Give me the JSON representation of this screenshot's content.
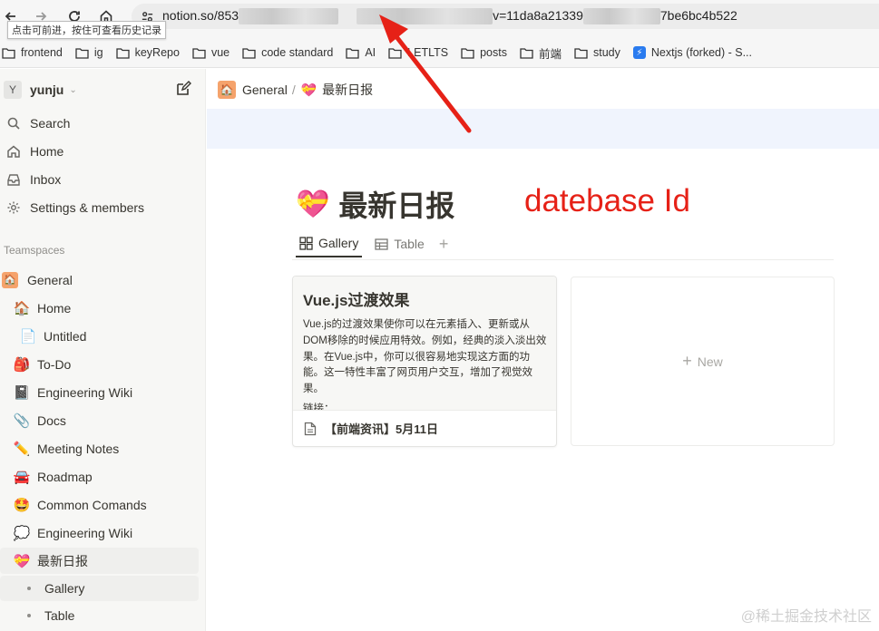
{
  "browser": {
    "url_host": "notion.so/853",
    "url_mid": "v=11da8a21339",
    "url_tail": "7be6bc4b522",
    "tooltip": "点击可前进，按住可查看历史记录"
  },
  "bookmarks": [
    {
      "label": "frontend",
      "icon": "folder-icon"
    },
    {
      "label": "ig",
      "icon": "folder-icon"
    },
    {
      "label": "keyRepo",
      "icon": "folder-icon"
    },
    {
      "label": "vue",
      "icon": "folder-icon"
    },
    {
      "label": "code standard",
      "icon": "folder-icon"
    },
    {
      "label": "AI",
      "icon": "folder-icon"
    },
    {
      "label": "LETLTS",
      "icon": "folder-icon"
    },
    {
      "label": "posts",
      "icon": "folder-icon"
    },
    {
      "label": "前端",
      "icon": "folder-icon"
    },
    {
      "label": "study",
      "icon": "folder-icon"
    },
    {
      "label": "Nextjs (forked) - S...",
      "icon": "bolt-icon"
    }
  ],
  "sidebar": {
    "workspace": {
      "avatar": "Y",
      "name": "yunju"
    },
    "nav": [
      {
        "label": "Search",
        "icon": "search-icon"
      },
      {
        "label": "Home",
        "icon": "home-icon"
      },
      {
        "label": "Inbox",
        "icon": "inbox-icon"
      },
      {
        "label": "Settings & members",
        "icon": "gear-icon"
      }
    ],
    "section_label": "Teamspaces",
    "teamspace": {
      "label": "General",
      "emoji": "🏠"
    },
    "pages": [
      {
        "label": "Home",
        "emoji": "🏠"
      },
      {
        "label": "Untitled",
        "emoji": "📄"
      },
      {
        "label": "To-Do",
        "emoji": "🎒"
      },
      {
        "label": "Engineering Wiki",
        "emoji": "📓"
      },
      {
        "label": "Docs",
        "emoji": "📎"
      },
      {
        "label": "Meeting Notes",
        "emoji": "✏️"
      },
      {
        "label": "Roadmap",
        "emoji": "🚘"
      },
      {
        "label": "Common Comands",
        "emoji": "🤩"
      },
      {
        "label": "Engineering Wiki",
        "emoji": "💭"
      },
      {
        "label": "最新日报",
        "emoji": "💝"
      }
    ],
    "subpages": [
      {
        "label": "Gallery"
      },
      {
        "label": "Table"
      }
    ]
  },
  "main": {
    "breadcrumb": {
      "parent": "General",
      "separator": "/",
      "current": "最新日报",
      "parent_emoji": "🏠",
      "current_emoji": "💝"
    },
    "title": "最新日报",
    "title_emoji": "💝",
    "annotation": "datebase Id",
    "tabs": [
      {
        "label": "Gallery",
        "icon": "gallery-icon",
        "active": true
      },
      {
        "label": "Table",
        "icon": "table-icon",
        "active": false
      }
    ],
    "add_view": "+",
    "card": {
      "heading": "Vue.js过渡效果",
      "body": "Vue.js的过渡效果使你可以在元素插入、更新或从DOM移除的时候应用特效。例如，经典的淡入淡出效果。在Vue.js中，你可以很容易地实现这方面的功能。这一特性丰富了网页用户交互，增加了视觉效果。",
      "body_more": "链接：",
      "footer": "【前端资讯】5月11日"
    },
    "new_label": "New"
  },
  "watermark": "@稀土掘金技术社区",
  "colors": {
    "annotation": "#e62117",
    "sidebar_bg": "#f7f7f5",
    "banner": "#f0f4fd"
  }
}
